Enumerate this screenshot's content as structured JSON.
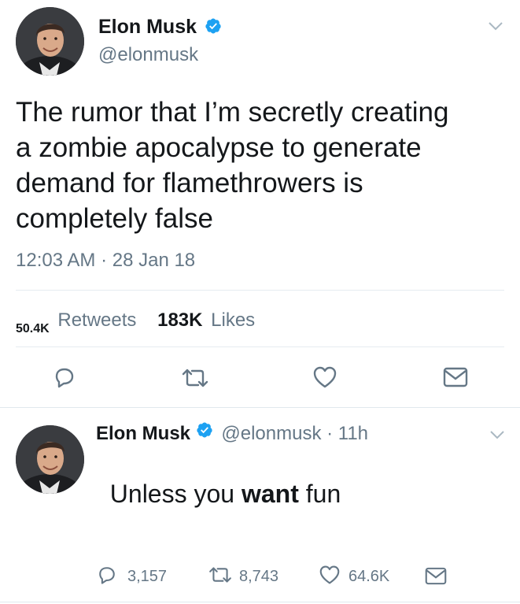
{
  "main_tweet": {
    "author_name": "Elon Musk",
    "handle": "@elonmusk",
    "text_lines": [
      "The rumor that I’m secretly creating",
      "a zombie apocalypse to generate",
      "demand for flamethrowers is",
      "completely false"
    ],
    "timestamp": "12:03 AM · 28 Jan 18",
    "retweets_count": "50.4K",
    "retweets_label": "Retweets",
    "likes_count": "183K",
    "likes_label": "Likes"
  },
  "reply_tweet": {
    "author_name": "Elon Musk",
    "handle_time": "@elonmusk · 11h",
    "text_prefix": "Unless you ",
    "text_bold": "want",
    "text_suffix": " fun",
    "reply_count": "3,157",
    "retweet_count": "8,743",
    "like_count": "64.6K"
  },
  "icons": [
    "verified-badge-icon",
    "chevron-down-icon",
    "reply-icon",
    "retweet-icon",
    "like-icon",
    "direct-message-icon"
  ],
  "colors": {
    "verified": "#1da1f2",
    "secondary_text": "#657786",
    "icon_gray": "#657786",
    "divider": "#e6ecf0"
  }
}
